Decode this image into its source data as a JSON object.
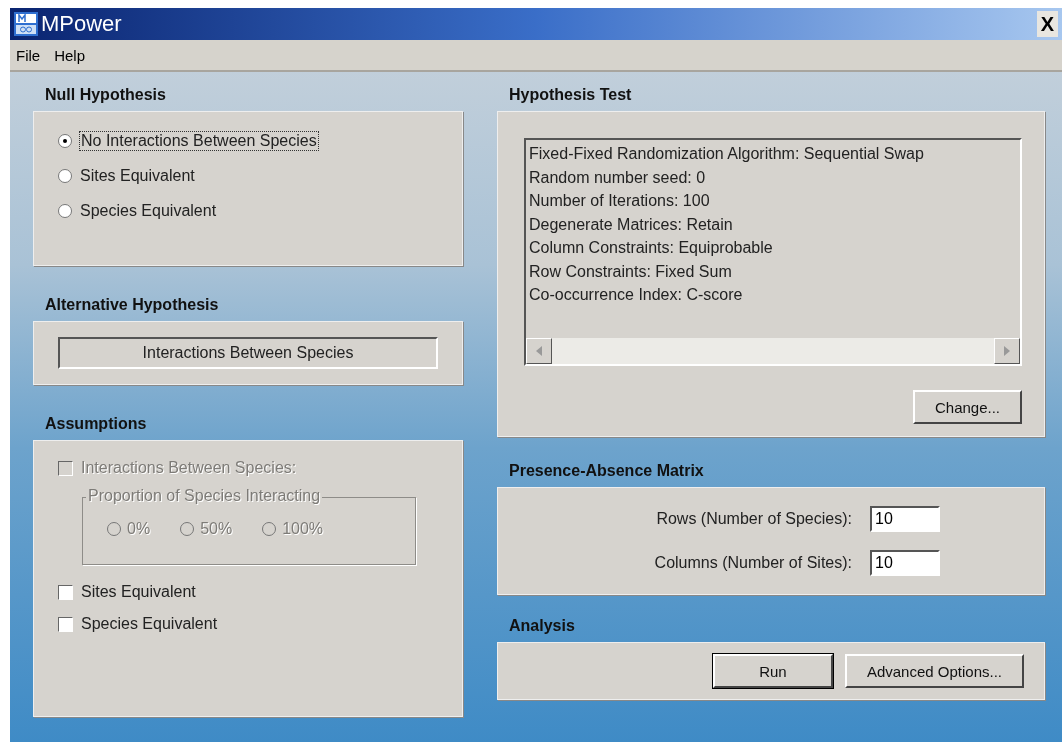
{
  "window": {
    "title": "MPower",
    "close": "X"
  },
  "menu": [
    "File",
    "Help"
  ],
  "null_hypothesis": {
    "title": "Null Hypothesis",
    "options": [
      {
        "label": "No Interactions Between Species",
        "selected": true,
        "focused": true
      },
      {
        "label": "Sites Equivalent",
        "selected": false,
        "focused": false
      },
      {
        "label": "Species Equivalent",
        "selected": false,
        "focused": false
      }
    ]
  },
  "alternative_hypothesis": {
    "title": "Alternative Hypothesis",
    "value": "Interactions Between Species"
  },
  "assumptions": {
    "title": "Assumptions",
    "items": [
      {
        "kind": "checkbox",
        "label": "Interactions Between Species:",
        "checked": false,
        "disabled": true
      },
      {
        "kind": "group",
        "label": "Proportion of Species Interacting",
        "disabled": true,
        "options": [
          {
            "label": "0%",
            "selected": false
          },
          {
            "label": "50%",
            "selected": false
          },
          {
            "label": "100%",
            "selected": false
          }
        ]
      },
      {
        "kind": "checkbox",
        "label": "Sites Equivalent",
        "checked": false,
        "disabled": false
      },
      {
        "kind": "checkbox",
        "label": "Species Equivalent",
        "checked": false,
        "disabled": false
      }
    ]
  },
  "hypothesis_test": {
    "title": "Hypothesis Test",
    "lines": [
      "Fixed-Fixed Randomization Algorithm: Sequential Swap",
      "Random number seed: 0",
      "Number of Iterations: 100",
      "Degenerate Matrices: Retain",
      "Column Constraints: Equiprobable",
      "Row Constraints: Fixed Sum",
      "Co-occurrence Index: C-score"
    ],
    "button": "Change..."
  },
  "matrix": {
    "title": "Presence-Absence Matrix",
    "fields": [
      {
        "label": "Rows (Number of Species):",
        "value": "10"
      },
      {
        "label": "Columns (Number of Sites):",
        "value": "10"
      }
    ]
  },
  "analysis": {
    "title": "Analysis",
    "buttons": [
      {
        "label": "Run",
        "default": true
      },
      {
        "label": "Advanced Options...",
        "default": false
      }
    ]
  }
}
